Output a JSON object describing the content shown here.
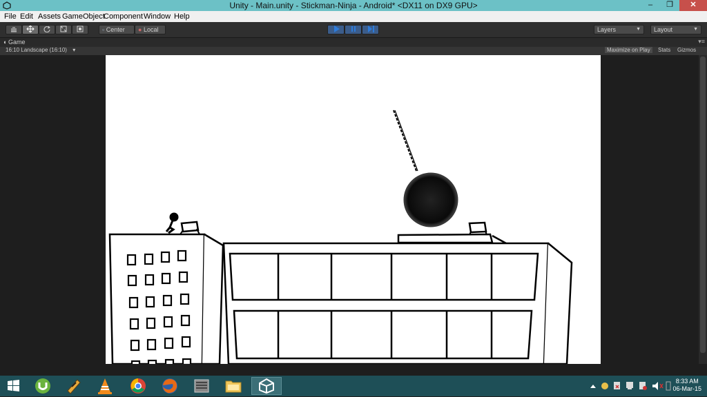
{
  "window": {
    "title": "Unity - Main.unity - Stickman-Ninja - Android* <DX11 on DX9 GPU>",
    "controls": {
      "minimize": "–",
      "maximize": "❐",
      "close": "✕"
    }
  },
  "menu": {
    "items": [
      "File",
      "Edit",
      "Assets",
      "GameObject",
      "Component",
      "Window",
      "Help"
    ]
  },
  "toolbar": {
    "tools": [
      "hand-icon",
      "move-icon",
      "rotate-icon",
      "scale-icon",
      "rect-icon"
    ],
    "pivot": "Center",
    "space": "Local",
    "layers": "Layers",
    "layout": "Layout"
  },
  "game_view": {
    "tab_label": "Game",
    "aspect": "16:10 Landscape (16:10)",
    "maximize_on_play": "Maximize on Play",
    "stats": "Stats",
    "gizmos": "Gizmos"
  },
  "taskbar": {
    "apps": [
      "windows-start-icon",
      "utorrent-icon",
      "winamp-icon",
      "vlc-icon",
      "chrome-icon",
      "firefox-icon",
      "terminal-icon",
      "file-explorer-icon",
      "unity-icon"
    ],
    "active_app": "unity-icon",
    "time": "8:33 AM",
    "date": "06-Mar-15"
  },
  "colors": {
    "titlebar": "#6cc1c6",
    "editor_bg": "#1e1e1e",
    "taskbar": "#1e4f57",
    "play_accent": "#2d7bd9"
  }
}
